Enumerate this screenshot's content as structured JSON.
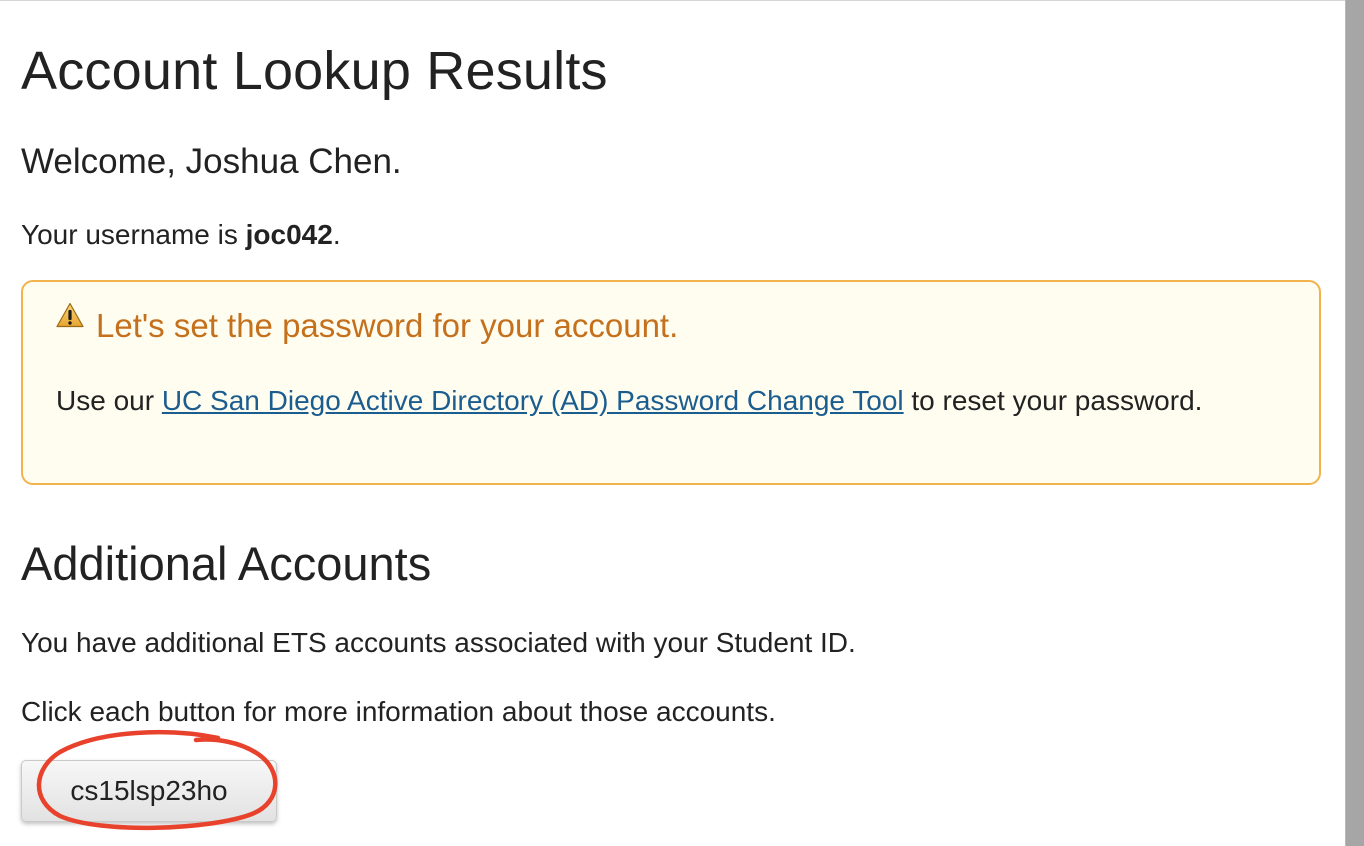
{
  "page": {
    "title": "Account Lookup Results",
    "welcome": "Welcome, Joshua Chen.",
    "username_prefix": "Your username is ",
    "username": "joc042",
    "username_suffix": "."
  },
  "alert": {
    "icon": "warning-icon",
    "title": "Let's set the password for your account.",
    "body_prefix": "Use our ",
    "link_text": "UC San Diego Active Directory (AD) Password Change Tool",
    "body_suffix": " to reset your password.",
    "colors": {
      "background": "#fefdf0",
      "border": "#f2b24d",
      "title": "#c4701c",
      "link": "#1c5d8f"
    }
  },
  "additional": {
    "title": "Additional Accounts",
    "line1": "You have additional ETS accounts associated with your Student ID.",
    "line2": "Click each button for more information about those accounts.",
    "accounts": [
      "cs15lsp23ho"
    ]
  },
  "annotation": {
    "shape": "hand-drawn-circle",
    "color": "#e8412c"
  }
}
